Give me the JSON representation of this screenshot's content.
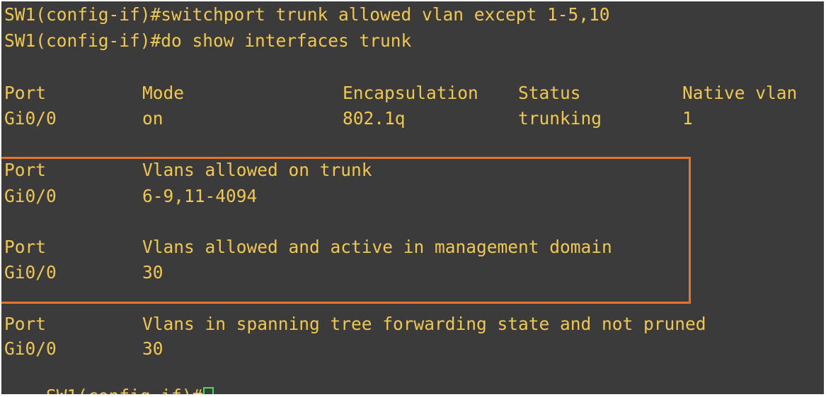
{
  "terminal": {
    "commands": {
      "cmd1": "SW1(config-if)#switchport trunk allowed vlan except 1-5,10",
      "cmd2": "SW1(config-if)#do show interfaces trunk",
      "prompt": "SW1(config-if)#"
    },
    "trunk_table": {
      "headers": {
        "port": "Port",
        "mode": "Mode",
        "encapsulation": "Encapsulation",
        "status": "Status",
        "native_vlan": "Native vlan"
      },
      "rows": [
        {
          "port": "Gi0/0",
          "mode": "on",
          "encapsulation": "802.1q",
          "status": "trunking",
          "native_vlan": "1"
        }
      ]
    },
    "sections": [
      {
        "header_port": "Port",
        "header_desc": "Vlans allowed on trunk",
        "row_port": "Gi0/0",
        "row_value": "6-9,11-4094"
      },
      {
        "header_port": "Port",
        "header_desc": "Vlans allowed and active in management domain",
        "row_port": "Gi0/0",
        "row_value": "30"
      },
      {
        "header_port": "Port",
        "header_desc": "Vlans in spanning tree forwarding state and not pruned",
        "row_port": "Gi0/0",
        "row_value": "30"
      }
    ],
    "colors": {
      "background": "#3b3b3b",
      "text": "#f0c850",
      "highlight": "#e8732c",
      "cursor": "#3fe05a"
    }
  }
}
